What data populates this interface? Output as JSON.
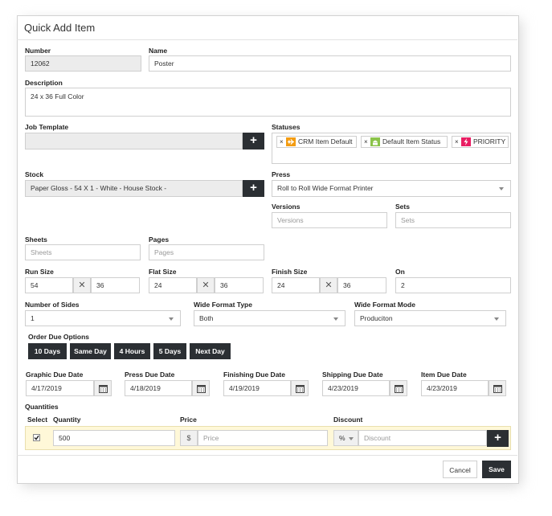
{
  "dialog": {
    "title": "Quick Add Item"
  },
  "fields": {
    "number": {
      "label": "Number",
      "value": "12062"
    },
    "name": {
      "label": "Name",
      "value": "Poster"
    },
    "description": {
      "label": "Description",
      "value": "24 x 36 Full Color"
    },
    "job_template": {
      "label": "Job Template",
      "value": ""
    },
    "statuses": {
      "label": "Statuses",
      "chips": [
        {
          "label": "CRM Item Default",
          "icon": "plane-icon",
          "color": "#f39c12"
        },
        {
          "label": "Default Item Status",
          "icon": "android-icon",
          "color": "#8bc34a"
        },
        {
          "label": "PRIORITY",
          "icon": "bolt-icon",
          "color": "#e91e63"
        }
      ]
    },
    "stock": {
      "label": "Stock",
      "value": "Paper Gloss - 54 X 1 - White - House Stock -"
    },
    "press": {
      "label": "Press",
      "value": "Roll to Roll Wide Format Printer"
    },
    "versions": {
      "label": "Versions",
      "placeholder": "Versions"
    },
    "sets": {
      "label": "Sets",
      "placeholder": "Sets"
    },
    "sheets": {
      "label": "Sheets",
      "placeholder": "Sheets"
    },
    "pages": {
      "label": "Pages",
      "placeholder": "Pages"
    },
    "run_size": {
      "label": "Run Size",
      "w": "54",
      "h": "36"
    },
    "flat_size": {
      "label": "Flat Size",
      "w": "24",
      "h": "36"
    },
    "finish_size": {
      "label": "Finish Size",
      "w": "24",
      "h": "36"
    },
    "on": {
      "label": "On",
      "value": "2"
    },
    "number_of_sides": {
      "label": "Number of Sides",
      "value": "1"
    },
    "wide_format_type": {
      "label": "Wide Format Type",
      "value": "Both"
    },
    "wide_format_mode": {
      "label": "Wide Format Mode",
      "value": "Produciton"
    },
    "times_symbol": "✕"
  },
  "order_due": {
    "label": "Order Due Options",
    "buttons": [
      "10 Days",
      "Same Day",
      "4 Hours",
      "5 Days",
      "Next Day"
    ]
  },
  "due_dates": [
    {
      "label": "Graphic Due Date",
      "value": "4/17/2019"
    },
    {
      "label": "Press Due Date",
      "value": "4/18/2019"
    },
    {
      "label": "Finishing Due Date",
      "value": "4/19/2019"
    },
    {
      "label": "Shipping Due Date",
      "value": "4/23/2019"
    },
    {
      "label": "Item Due Date",
      "value": "4/23/2019"
    }
  ],
  "quantities": {
    "label": "Quantities",
    "headers": {
      "select": "Select",
      "quantity": "Quantity",
      "price": "Price",
      "discount": "Discount"
    },
    "row": {
      "selected": true,
      "quantity": "500",
      "price_prefix": "$",
      "price_placeholder": "Price",
      "discount_type": "%",
      "discount_placeholder": "Discount"
    }
  },
  "footer": {
    "cancel": "Cancel",
    "save": "Save"
  },
  "plus_symbol": "+"
}
